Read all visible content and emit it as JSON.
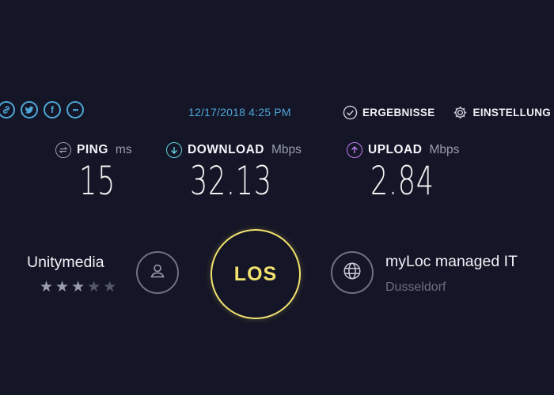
{
  "share": {
    "icons": [
      "link-icon",
      "twitter-icon",
      "facebook-icon",
      "more-icon"
    ],
    "facebook_glyph": "f",
    "more_glyph": "•••"
  },
  "timestamp": "12/17/2018 4:25 PM",
  "nav": {
    "results_label": "ERGEBNISSE",
    "settings_label": "EINSTELLUNG"
  },
  "metrics": {
    "ping": {
      "label": "PING",
      "unit": "ms",
      "value": "15",
      "color": "#9a9cb0"
    },
    "download": {
      "label": "DOWNLOAD",
      "unit": "Mbps",
      "value": "32.13",
      "color": "#5fd1dd"
    },
    "upload": {
      "label": "UPLOAD",
      "unit": "Mbps",
      "value": "2.84",
      "color": "#c07cf0"
    }
  },
  "provider": {
    "name": "Unitymedia",
    "rating": 3,
    "rating_max": 5
  },
  "go_button": {
    "label": "LOS",
    "color": "#f2e36e"
  },
  "server": {
    "name": "myLoc managed IT",
    "location": "Dusseldorf"
  },
  "colors": {
    "background": "#141526",
    "accent_blue": "#4ea7d8"
  }
}
